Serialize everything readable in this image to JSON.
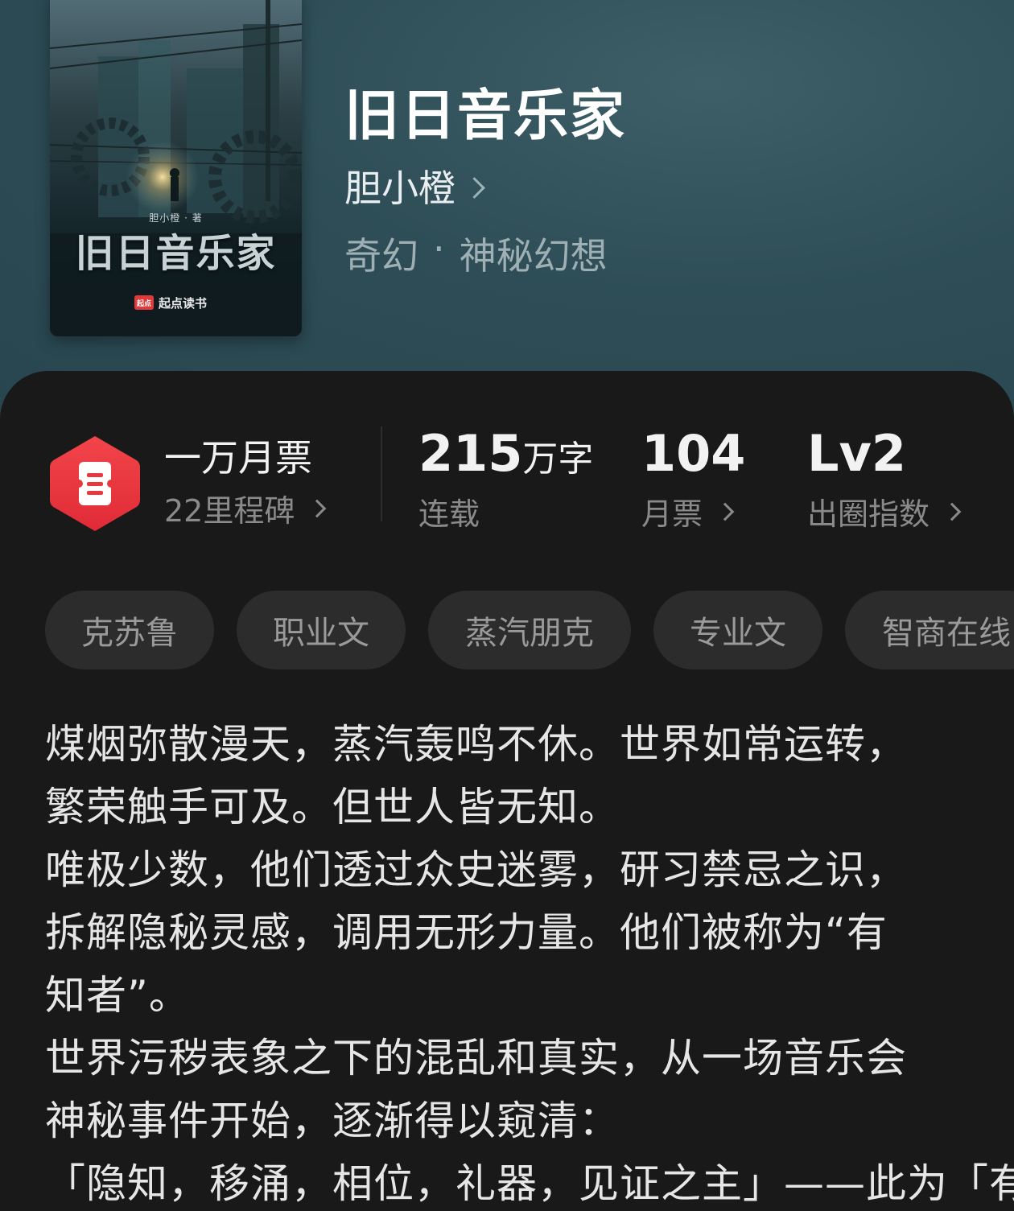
{
  "book": {
    "title": "旧日音乐家",
    "author": "胆小橙",
    "category": "奇幻",
    "separator": "·",
    "subcategory": "神秘幻想"
  },
  "cover": {
    "title": "旧日音乐家",
    "author_line": "胆小橙 · 著",
    "brand": "起点读书",
    "brand_logo": "起点"
  },
  "stats": {
    "badge_icon": "ticket-icon",
    "badge_color": "#e8373f",
    "badge_title": "一万月票",
    "badge_sub": "22里程碑",
    "word_count_number": "215",
    "word_count_unit": "万字",
    "status": "连载",
    "monthly_tickets": "104",
    "monthly_tickets_label": "月票",
    "level": "Lv2",
    "level_label": "出圈指数"
  },
  "tags": [
    "克苏鲁",
    "职业文",
    "蒸汽朋克",
    "专业文",
    "智商在线"
  ],
  "description": [
    "煤烟弥散漫天，蒸汽轰鸣不休。世界如常运转，",
    "繁荣触手可及。但世人皆无知。",
    "唯极少数，他们透过众史迷雾，研习禁忌之识，",
    "拆解隐秘灵感，调用无形力量。他们被称为“有",
    "知者”。",
    "世界污秽表象之下的混乱和真实，从一场音乐会",
    "神秘事件开始，逐渐得以窥清：",
    "「隐知，移涌，相位，礼器，见证之主」——此为「有"
  ]
}
